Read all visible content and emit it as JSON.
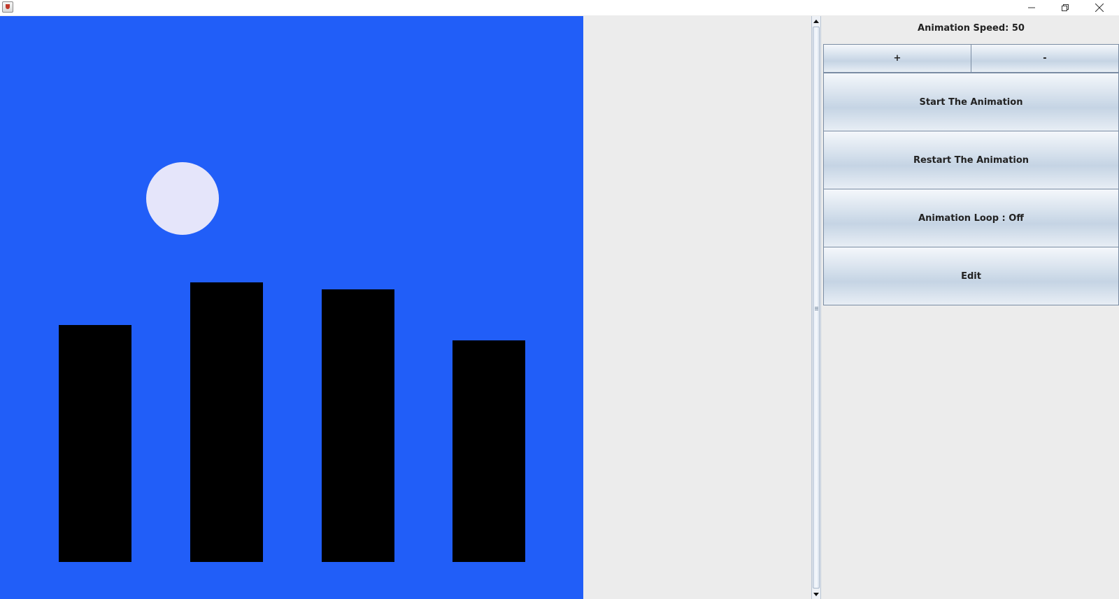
{
  "titlebar": {
    "app_icon": "java-cup-icon",
    "controls": [
      "minimize-icon",
      "maximize-icon",
      "close-icon"
    ]
  },
  "scene": {
    "background_color": "#215ef8",
    "moon_color": "#e5e5fa",
    "bar_color": "#000000"
  },
  "panel": {
    "speed_label": "Animation Speed: 50",
    "increase_label": "+",
    "decrease_label": "-",
    "start_label": "Start The Animation",
    "restart_label": "Restart The Animation",
    "loop_label": "Animation Loop : Off",
    "edit_label": "Edit"
  }
}
